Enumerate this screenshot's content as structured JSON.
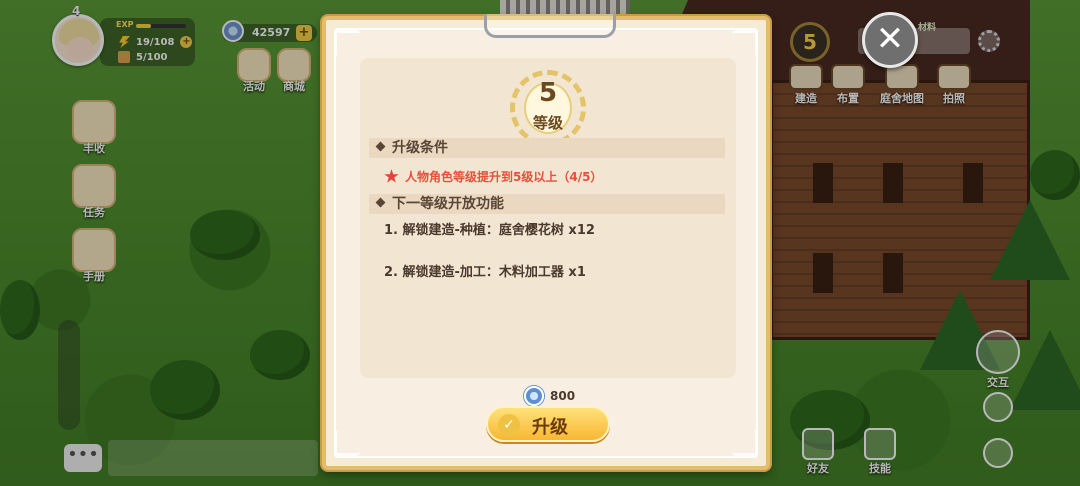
{
  "hud": {
    "level": "4",
    "exp_label": "EXP",
    "exp_fraction": 0.3,
    "energy": "19/108",
    "bag": "5/100",
    "coins": "42597",
    "coin_plus": "+",
    "energy_plus": "+"
  },
  "left_menu": [
    {
      "label": "活动",
      "icon": "event-icon"
    },
    {
      "label": "商城",
      "icon": "shop-icon"
    },
    {
      "label": "丰收",
      "icon": "harvest-icon"
    },
    {
      "label": "任务",
      "icon": "quest-icon"
    },
    {
      "label": "手册",
      "icon": "handbook-icon"
    }
  ],
  "chat": {
    "button": "•••"
  },
  "right_top": {
    "level_badge": "5",
    "material_label": "材料"
  },
  "top_menu": [
    {
      "label": "建造",
      "icon": "build-icon"
    },
    {
      "label": "布置",
      "icon": "decorate-icon"
    },
    {
      "label": "庭舍地图",
      "icon": "map-icon"
    },
    {
      "label": "拍照",
      "icon": "camera-icon"
    }
  ],
  "right_menu": [
    {
      "label": "交互",
      "icon": "hand-icon"
    },
    {
      "label": "好友",
      "icon": "friends-icon"
    },
    {
      "label": "技能",
      "icon": "skills-icon"
    }
  ],
  "modal": {
    "badge_number": "5",
    "badge_label": "等级",
    "conditions_title": "升级条件",
    "condition_text": "人物角色等级提升到5级以上（4/5）",
    "features_title": "下一等级开放功能",
    "features": [
      "1. 解锁建造-种植：庭舍樱花树 x12",
      "2. 解锁建造-加工：木料加工器 x1"
    ],
    "cost": "800",
    "upgrade_label": "升级",
    "close_label": "✕"
  }
}
